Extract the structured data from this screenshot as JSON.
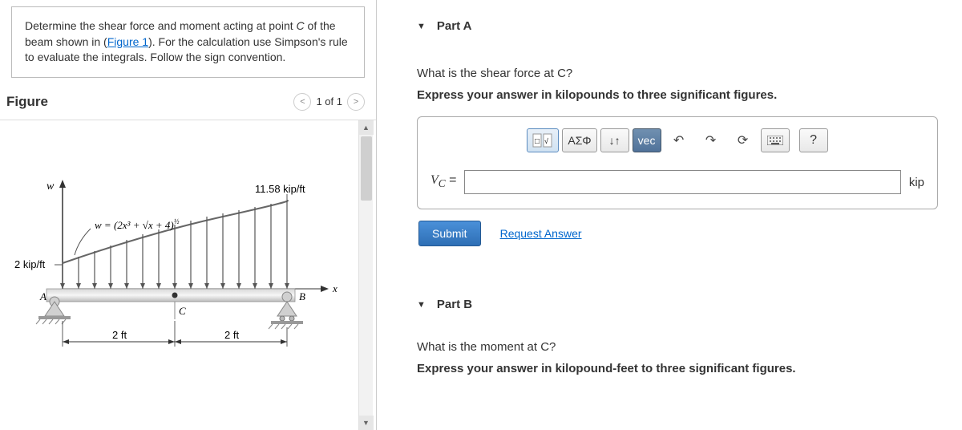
{
  "problem": {
    "text_prefix": "Determine the shear force and moment acting at point ",
    "point_name": "C",
    "text_mid": " of the beam shown in (",
    "link_text": "Figure 1",
    "text_suffix": "). For the calculation use Simpson's rule to evaluate the integrals. Follow the sign convention."
  },
  "figure": {
    "title": "Figure",
    "nav_prev": "<",
    "nav_count": "1 of 1",
    "nav_next": ">",
    "labels": {
      "w": "w",
      "formula": "w = (2x³ + √x + 4)",
      "exponent": "½",
      "right_load": "11.58 kip/ft",
      "left_load": "2 kip/ft",
      "A": "A",
      "B": "B",
      "C": "C",
      "x": "x",
      "span1": "2 ft",
      "span2": "2 ft"
    }
  },
  "partA": {
    "title": "Part A",
    "question": "What is the shear force at C?",
    "instruction": "Express your answer in kilopounds to three significant figures.",
    "toolbar": {
      "template": "x√□",
      "greek": "ΑΣΦ",
      "arrows": "↓↑",
      "vec": "vec",
      "undo": "↶",
      "redo": "↷",
      "reset": "⟳",
      "keyboard": "⌨",
      "help": "?"
    },
    "lhs_var": "V",
    "lhs_sub": "C",
    "equals": " =",
    "unit": "kip",
    "submit": "Submit",
    "request": "Request Answer"
  },
  "partB": {
    "title": "Part B",
    "question": "What is the moment at C?",
    "instruction": "Express your answer in kilopound-feet to three significant figures."
  }
}
